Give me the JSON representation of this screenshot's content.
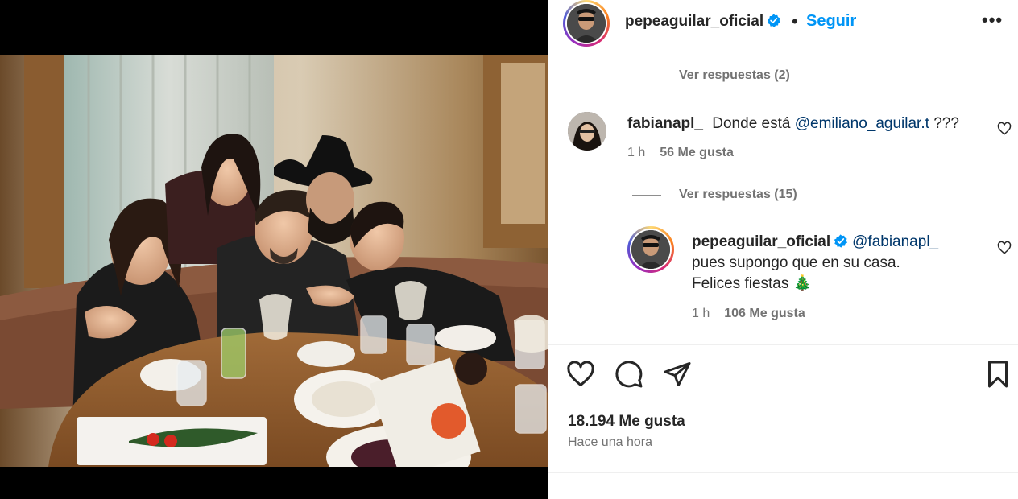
{
  "post": {
    "username": "pepeaguilar_oficial",
    "separator": "•",
    "follow_label": "Seguir",
    "more_label": "•••"
  },
  "comments": {
    "replies_1": "Ver respuestas (2)",
    "comment_1": {
      "username": "fabianapl_",
      "text_before": "Donde está",
      "mention": "@emiliano_aguilar.t",
      "text_after": "???",
      "time": "1 h",
      "likes": "56 Me gusta"
    },
    "replies_2": "Ver respuestas (15)",
    "reply_1": {
      "username": "pepeaguilar_oficial",
      "mention": "@fabianapl_",
      "line_2": "pues supongo que en su casa.",
      "line_3": "Felices fiestas",
      "emoji": "🎄",
      "time": "1 h",
      "likes": "106 Me gusta"
    }
  },
  "footer": {
    "likes_total": "18.194 Me gusta",
    "time_ago": "Hace una hora"
  },
  "colors": {
    "link_blue": "#0095f6",
    "mention_blue": "#00376b",
    "verified_blue": "#0095f6",
    "muted_text": "#737373"
  },
  "icons": {
    "like": "heart-icon",
    "comment": "comment-bubble-icon",
    "share": "paper-plane-icon",
    "save": "bookmark-icon",
    "verified": "verified-badge-icon"
  }
}
